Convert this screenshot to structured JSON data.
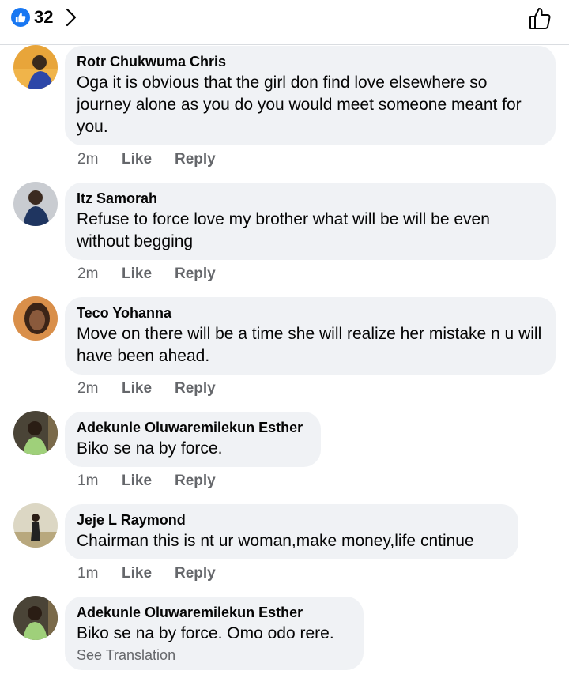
{
  "header": {
    "reaction_count": "32",
    "accent": "#1877f2"
  },
  "comments": [
    {
      "author": "Rotr Chukwuma Chris",
      "text": "Oga it is obvious that the girl don find love elsewhere so journey alone as you do you would meet someone meant for you.",
      "time": "2m",
      "like": "Like",
      "reply": "Reply"
    },
    {
      "author": "Itz Samorah",
      "text": "Refuse to force love my brother what will be will be even without begging",
      "time": "2m",
      "like": "Like",
      "reply": "Reply"
    },
    {
      "author": "Teco Yohanna",
      "text": "Move on there will be a time she will realize her mistake n u will have been ahead.",
      "time": "2m",
      "like": "Like",
      "reply": "Reply"
    },
    {
      "author": "Adekunle Oluwaremilekun Esther",
      "text": "Biko se na by force.",
      "time": "1m",
      "like": "Like",
      "reply": "Reply"
    },
    {
      "author": "Jeje L Raymond",
      "text": "Chairman this is nt ur woman,make money,life cntinue",
      "time": "1m",
      "like": "Like",
      "reply": "Reply"
    },
    {
      "author": "Adekunle Oluwaremilekun Esther",
      "text": "Biko se na by force. Omo odo rere.",
      "see_translation": "See Translation"
    }
  ]
}
